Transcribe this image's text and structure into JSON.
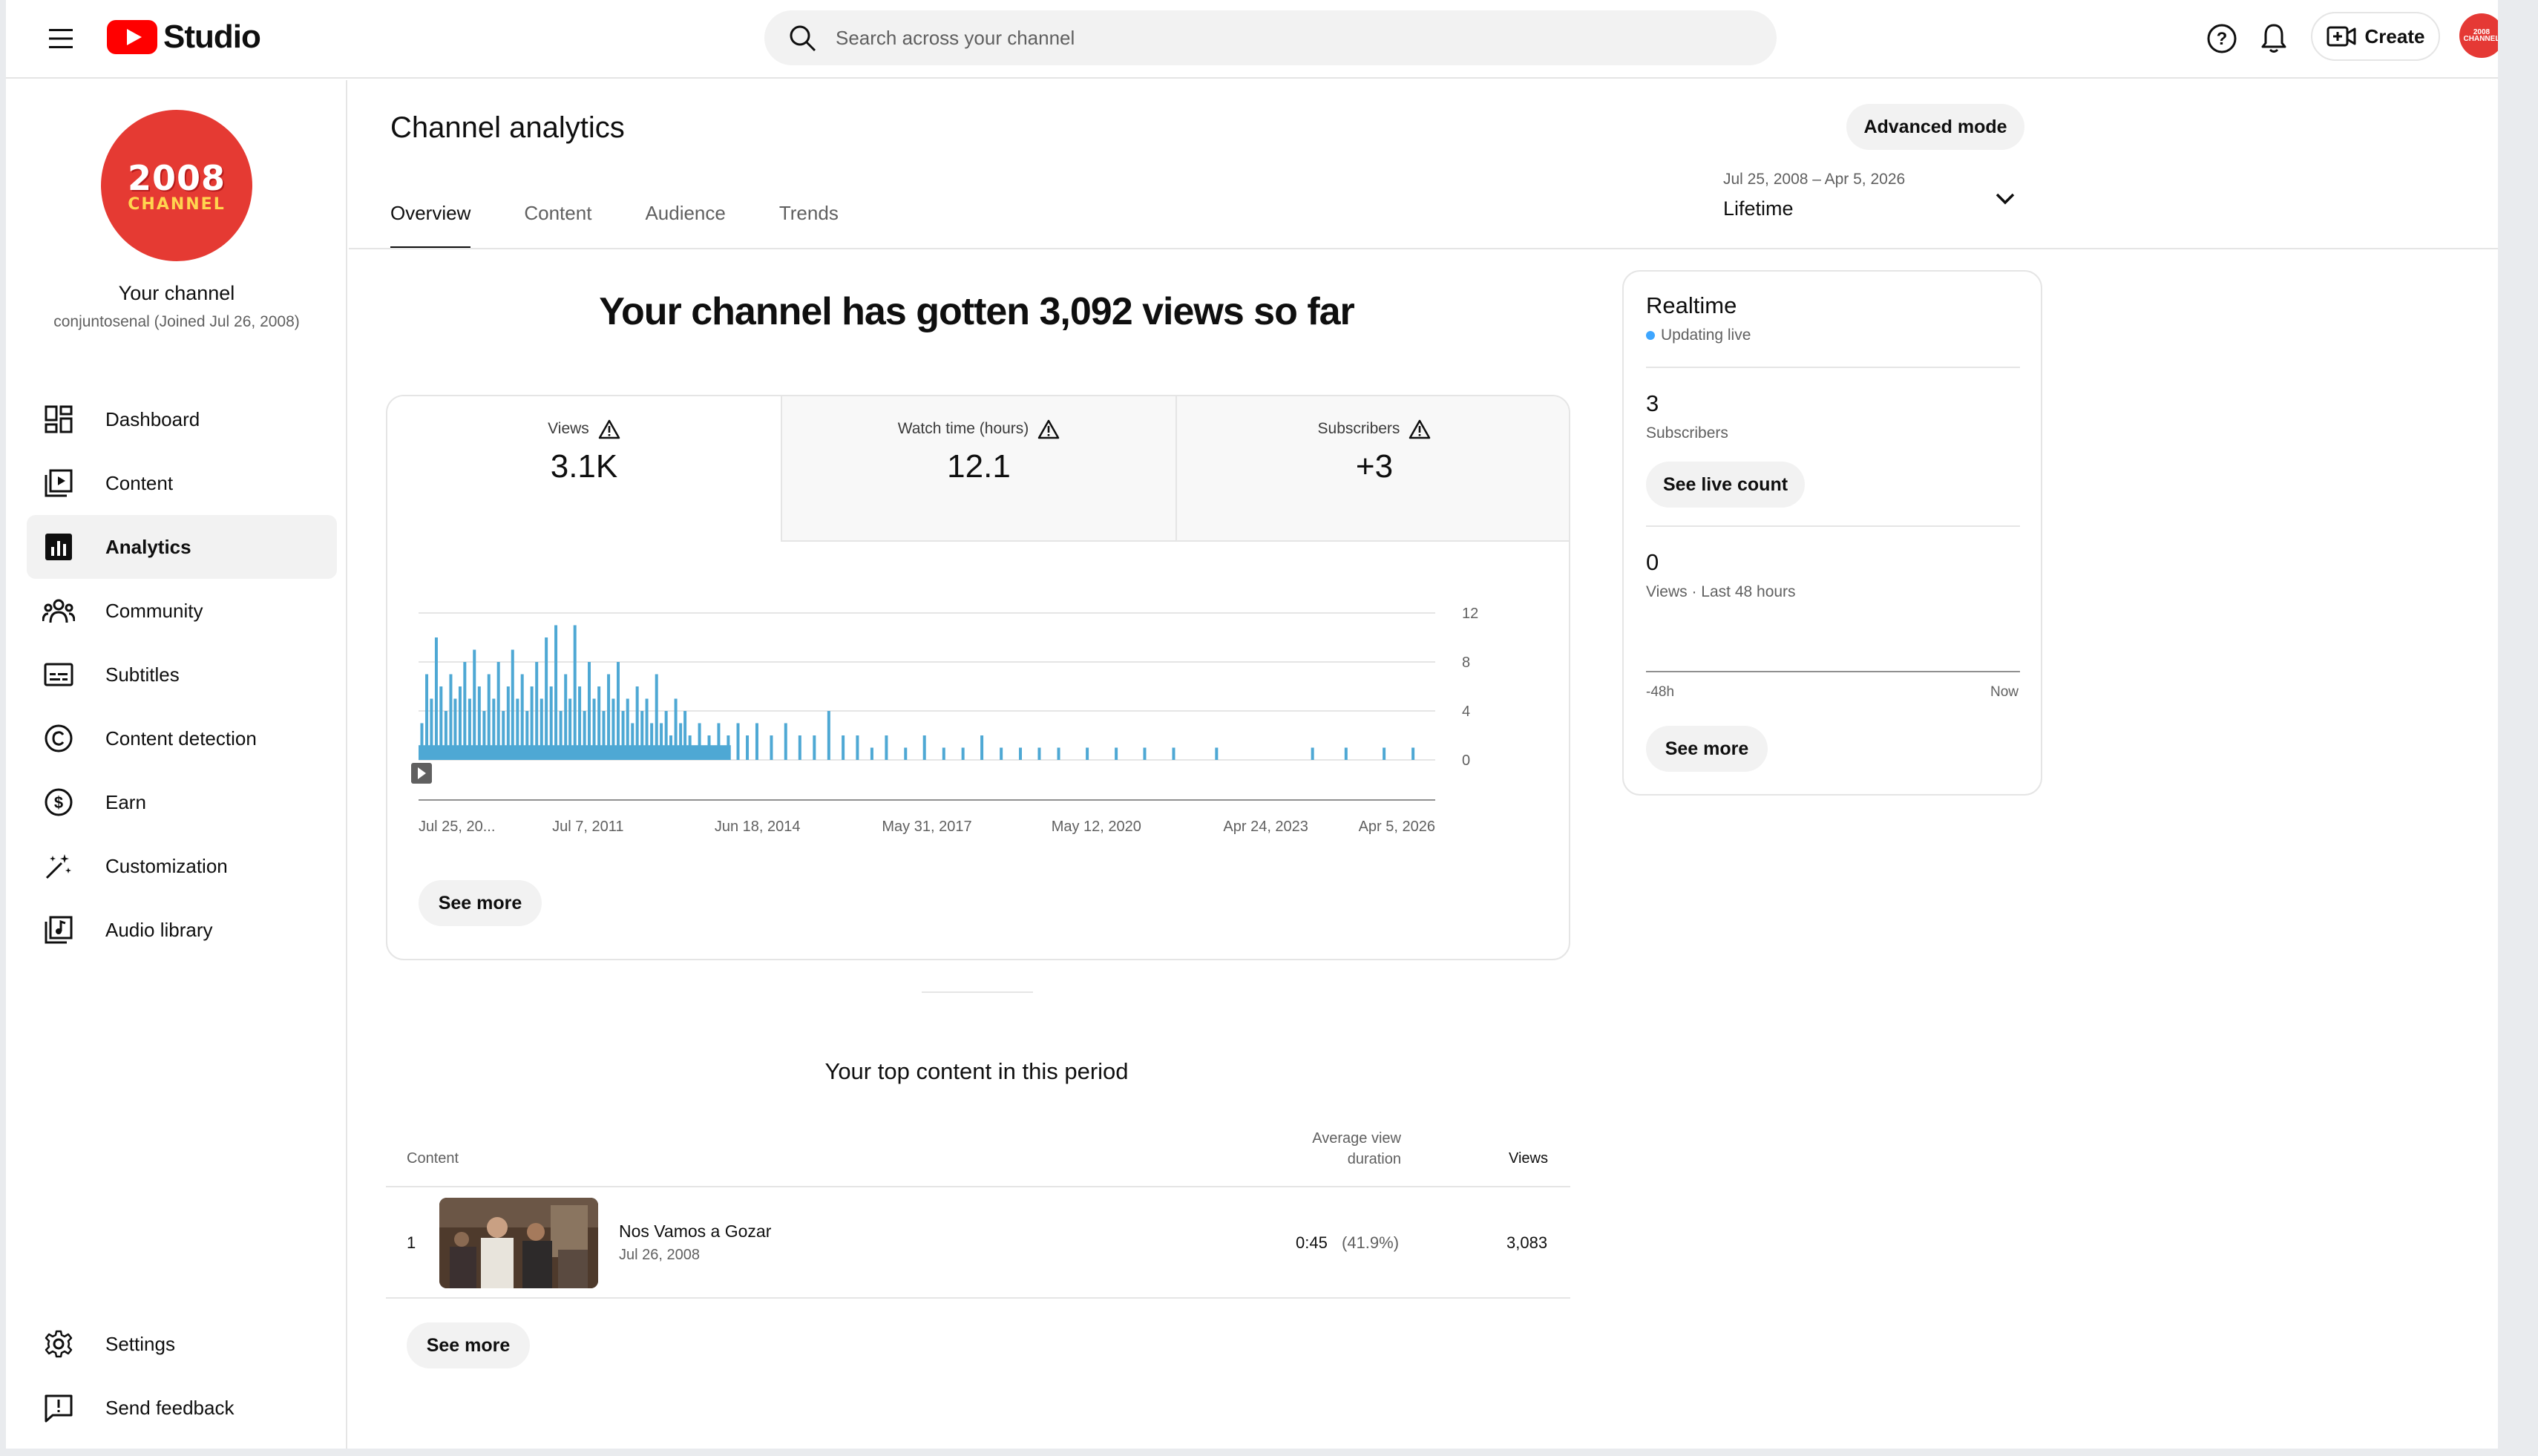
{
  "header": {
    "logo_text": "Studio",
    "search_placeholder": "Search across your channel",
    "create_label": "Create",
    "avatar_text": "2008 CHANNEL"
  },
  "sidebar": {
    "avatar_line1": "2008",
    "avatar_line2": "CHANNEL",
    "channel_name": "Your channel",
    "channel_sub": "conjuntosenal (Joined Jul 26, 2008)",
    "items": [
      {
        "label": "Dashboard",
        "icon": "dashboard-icon"
      },
      {
        "label": "Content",
        "icon": "content-icon"
      },
      {
        "label": "Analytics",
        "icon": "analytics-icon"
      },
      {
        "label": "Community",
        "icon": "community-icon"
      },
      {
        "label": "Subtitles",
        "icon": "subtitles-icon"
      },
      {
        "label": "Content detection",
        "icon": "copyright-icon"
      },
      {
        "label": "Earn",
        "icon": "dollar-icon"
      },
      {
        "label": "Customization",
        "icon": "magic-wand-icon"
      },
      {
        "label": "Audio library",
        "icon": "audio-library-icon"
      }
    ],
    "footer_items": [
      {
        "label": "Settings",
        "icon": "gear-icon"
      },
      {
        "label": "Send feedback",
        "icon": "feedback-icon"
      }
    ]
  },
  "main": {
    "title": "Channel analytics",
    "advanced_mode_label": "Advanced mode",
    "tabs": [
      {
        "label": "Overview"
      },
      {
        "label": "Content"
      },
      {
        "label": "Audience"
      },
      {
        "label": "Trends"
      }
    ],
    "date_range": {
      "range": "Jul 25, 2008 – Apr 5, 2026",
      "label": "Lifetime"
    },
    "headline": "Your channel has gotten 3,092 views so far",
    "metrics": [
      {
        "label": "Views",
        "value": "3.1K"
      },
      {
        "label": "Watch time (hours)",
        "value": "12.1"
      },
      {
        "label": "Subscribers",
        "value": "+3"
      }
    ],
    "see_more_chart": "See more",
    "top_content": {
      "title": "Your top content in this period",
      "col_content": "Content",
      "col_avg_line1": "Average view",
      "col_avg_line2": "duration",
      "col_views": "Views",
      "rows": [
        {
          "rank": "1",
          "title": "Nos Vamos a Gozar",
          "date": "Jul 26, 2008",
          "avg": "0:45",
          "avg_pct": "(41.9%)",
          "views": "3,083"
        }
      ],
      "see_more": "See more"
    }
  },
  "realtime": {
    "title": "Realtime",
    "live_text": "Updating live",
    "subs_value": "3",
    "subs_label": "Subscribers",
    "see_live_label": "See live count",
    "views_value": "0",
    "views_label": "Views · Last 48 hours",
    "axis_left": "-48h",
    "axis_right": "Now",
    "see_more": "See more"
  },
  "chart_data": {
    "type": "bar",
    "title": "",
    "xlabel": "",
    "ylabel": "",
    "ylim": [
      0,
      12
    ],
    "y_ticks": [
      0,
      4,
      8,
      12
    ],
    "x_tick_labels": [
      "Jul 25, 20...",
      "Jul 7, 2011",
      "Jun 18, 2014",
      "May 31, 2017",
      "May 12, 2020",
      "Apr 24, 2023",
      "Apr 5, 2026"
    ],
    "x_range": [
      "2008-07-25",
      "2026-04-05"
    ],
    "color": "#4ea8d4",
    "series": [
      {
        "granularity": "daily views (approximated)",
        "points": [
          {
            "x": "2008-08",
            "y": 3
          },
          {
            "x": "2008-09",
            "y": 7
          },
          {
            "x": "2008-10",
            "y": 5
          },
          {
            "x": "2008-11",
            "y": 10
          },
          {
            "x": "2008-12",
            "y": 6
          },
          {
            "x": "2009-01",
            "y": 4
          },
          {
            "x": "2009-02",
            "y": 7
          },
          {
            "x": "2009-03",
            "y": 5
          },
          {
            "x": "2009-04",
            "y": 6
          },
          {
            "x": "2009-05",
            "y": 8
          },
          {
            "x": "2009-06",
            "y": 5
          },
          {
            "x": "2009-07",
            "y": 9
          },
          {
            "x": "2009-08",
            "y": 6
          },
          {
            "x": "2009-09",
            "y": 4
          },
          {
            "x": "2009-10",
            "y": 7
          },
          {
            "x": "2009-11",
            "y": 5
          },
          {
            "x": "2009-12",
            "y": 8
          },
          {
            "x": "2010-01",
            "y": 4
          },
          {
            "x": "2010-02",
            "y": 6
          },
          {
            "x": "2010-03",
            "y": 9
          },
          {
            "x": "2010-04",
            "y": 5
          },
          {
            "x": "2010-05",
            "y": 7
          },
          {
            "x": "2010-06",
            "y": 4
          },
          {
            "x": "2010-07",
            "y": 6
          },
          {
            "x": "2010-08",
            "y": 8
          },
          {
            "x": "2010-09",
            "y": 5
          },
          {
            "x": "2010-10",
            "y": 10
          },
          {
            "x": "2010-11",
            "y": 6
          },
          {
            "x": "2010-12",
            "y": 11
          },
          {
            "x": "2011-01",
            "y": 4
          },
          {
            "x": "2011-02",
            "y": 7
          },
          {
            "x": "2011-03",
            "y": 5
          },
          {
            "x": "2011-04",
            "y": 11
          },
          {
            "x": "2011-05",
            "y": 6
          },
          {
            "x": "2011-06",
            "y": 4
          },
          {
            "x": "2011-07",
            "y": 8
          },
          {
            "x": "2011-08",
            "y": 5
          },
          {
            "x": "2011-09",
            "y": 6
          },
          {
            "x": "2011-10",
            "y": 4
          },
          {
            "x": "2011-11",
            "y": 7
          },
          {
            "x": "2011-12",
            "y": 5
          },
          {
            "x": "2012-01",
            "y": 8
          },
          {
            "x": "2012-02",
            "y": 4
          },
          {
            "x": "2012-03",
            "y": 5
          },
          {
            "x": "2012-04",
            "y": 3
          },
          {
            "x": "2012-05",
            "y": 6
          },
          {
            "x": "2012-06",
            "y": 4
          },
          {
            "x": "2012-07",
            "y": 5
          },
          {
            "x": "2012-08",
            "y": 3
          },
          {
            "x": "2012-09",
            "y": 7
          },
          {
            "x": "2012-10",
            "y": 3
          },
          {
            "x": "2012-11",
            "y": 4
          },
          {
            "x": "2012-12",
            "y": 2
          },
          {
            "x": "2013-01",
            "y": 5
          },
          {
            "x": "2013-02",
            "y": 3
          },
          {
            "x": "2013-03",
            "y": 4
          },
          {
            "x": "2013-04",
            "y": 2
          },
          {
            "x": "2013-06",
            "y": 3
          },
          {
            "x": "2013-08",
            "y": 2
          },
          {
            "x": "2013-10",
            "y": 3
          },
          {
            "x": "2013-12",
            "y": 2
          },
          {
            "x": "2014-02",
            "y": 3
          },
          {
            "x": "2014-04",
            "y": 2
          },
          {
            "x": "2014-06",
            "y": 3
          },
          {
            "x": "2014-09",
            "y": 2
          },
          {
            "x": "2014-12",
            "y": 3
          },
          {
            "x": "2015-03",
            "y": 2
          },
          {
            "x": "2015-06",
            "y": 2
          },
          {
            "x": "2015-09",
            "y": 4
          },
          {
            "x": "2015-12",
            "y": 2
          },
          {
            "x": "2016-03",
            "y": 2
          },
          {
            "x": "2016-06",
            "y": 1
          },
          {
            "x": "2016-09",
            "y": 2
          },
          {
            "x": "2017-01",
            "y": 1
          },
          {
            "x": "2017-05",
            "y": 2
          },
          {
            "x": "2017-09",
            "y": 1
          },
          {
            "x": "2018-01",
            "y": 1
          },
          {
            "x": "2018-05",
            "y": 2
          },
          {
            "x": "2018-09",
            "y": 1
          },
          {
            "x": "2019-01",
            "y": 1
          },
          {
            "x": "2019-05",
            "y": 1
          },
          {
            "x": "2019-09",
            "y": 1
          },
          {
            "x": "2020-03",
            "y": 1
          },
          {
            "x": "2020-09",
            "y": 1
          },
          {
            "x": "2021-03",
            "y": 1
          },
          {
            "x": "2021-09",
            "y": 1
          },
          {
            "x": "2022-06",
            "y": 1
          },
          {
            "x": "2024-02",
            "y": 1
          },
          {
            "x": "2024-09",
            "y": 1
          },
          {
            "x": "2025-05",
            "y": 1
          },
          {
            "x": "2025-11",
            "y": 1
          }
        ]
      }
    ]
  }
}
